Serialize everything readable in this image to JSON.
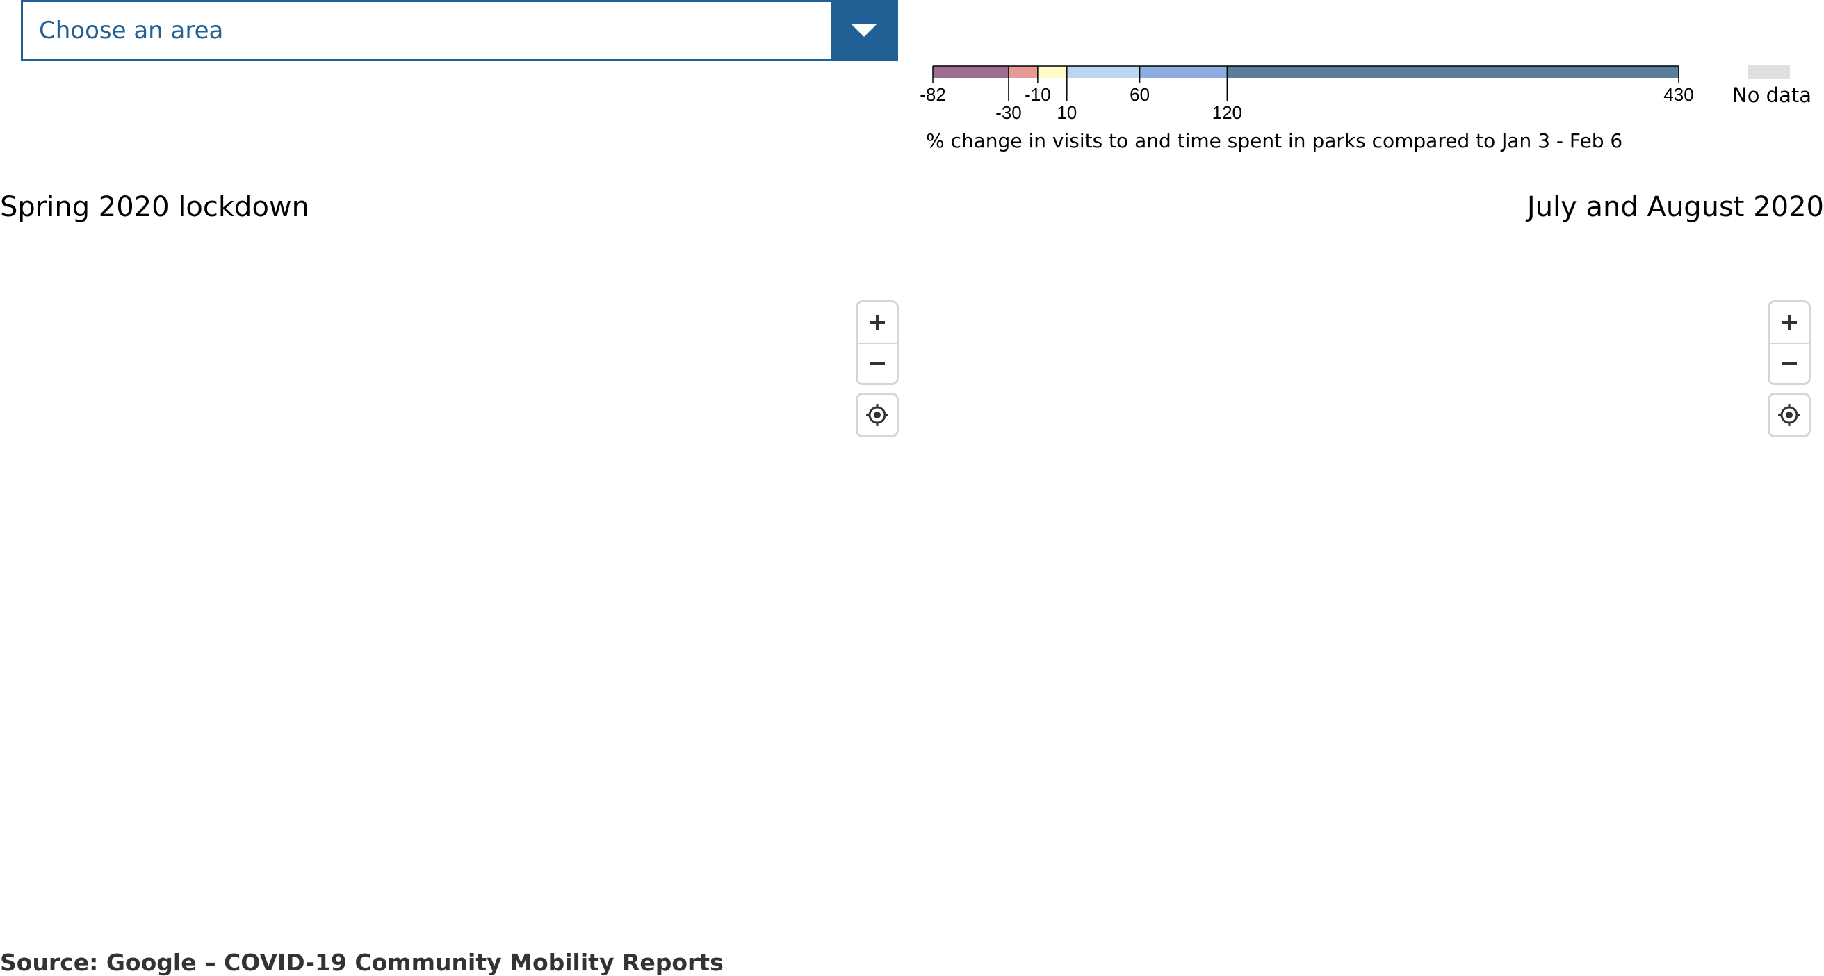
{
  "area_select": {
    "placeholder": "Choose an area",
    "toggle_icon": "chevron-down-icon"
  },
  "legend": {
    "breaks": [
      -82,
      -30,
      -10,
      10,
      60,
      120,
      430
    ],
    "break_labels": [
      "-82",
      "-30",
      "-10",
      "10",
      "60",
      "120",
      "430"
    ],
    "colors": [
      "#9e6f91",
      "#e59a95",
      "#fdfcc7",
      "#bad6f0",
      "#8dacdf",
      "#597d9b"
    ],
    "caption": "% change in visits to and time spent in parks compared to Jan 3 - Feb 6",
    "no_data_label": "No data",
    "no_data_color": "#e0e0e0"
  },
  "maps": [
    {
      "title": "Spring 2020 lockdown",
      "controls": {
        "zoom_in_icon": "plus-icon",
        "zoom_out_icon": "minus-icon",
        "locate_icon": "locate-icon"
      }
    },
    {
      "title": "July and August 2020",
      "controls": {
        "zoom_in_icon": "plus-icon",
        "zoom_out_icon": "minus-icon",
        "locate_icon": "locate-icon"
      }
    }
  ],
  "source": "Source: Google – COVID-19 Community Mobility Reports"
}
